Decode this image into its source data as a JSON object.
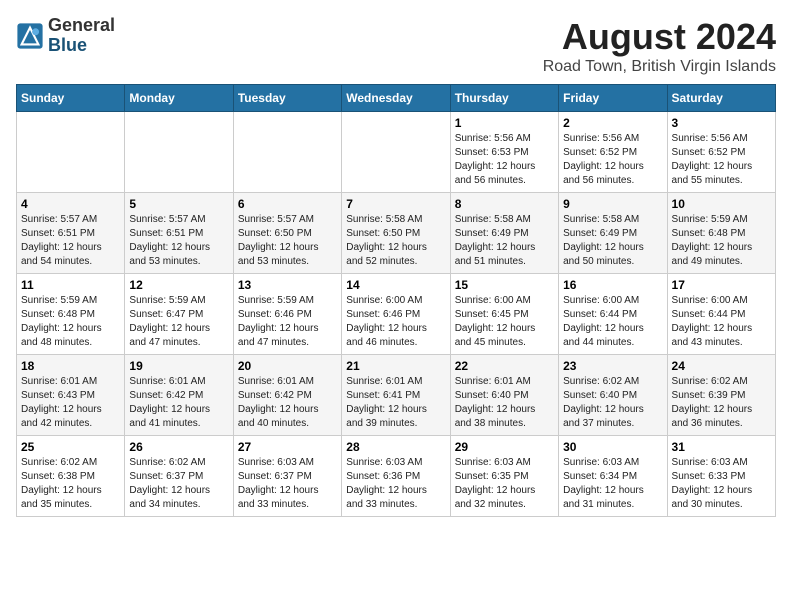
{
  "header": {
    "logo_general": "General",
    "logo_blue": "Blue",
    "month_year": "August 2024",
    "location": "Road Town, British Virgin Islands"
  },
  "calendar": {
    "weekdays": [
      "Sunday",
      "Monday",
      "Tuesday",
      "Wednesday",
      "Thursday",
      "Friday",
      "Saturday"
    ],
    "weeks": [
      [
        {
          "day": "",
          "info": ""
        },
        {
          "day": "",
          "info": ""
        },
        {
          "day": "",
          "info": ""
        },
        {
          "day": "",
          "info": ""
        },
        {
          "day": "1",
          "info": "Sunrise: 5:56 AM\nSunset: 6:53 PM\nDaylight: 12 hours\nand 56 minutes."
        },
        {
          "day": "2",
          "info": "Sunrise: 5:56 AM\nSunset: 6:52 PM\nDaylight: 12 hours\nand 56 minutes."
        },
        {
          "day": "3",
          "info": "Sunrise: 5:56 AM\nSunset: 6:52 PM\nDaylight: 12 hours\nand 55 minutes."
        }
      ],
      [
        {
          "day": "4",
          "info": "Sunrise: 5:57 AM\nSunset: 6:51 PM\nDaylight: 12 hours\nand 54 minutes."
        },
        {
          "day": "5",
          "info": "Sunrise: 5:57 AM\nSunset: 6:51 PM\nDaylight: 12 hours\nand 53 minutes."
        },
        {
          "day": "6",
          "info": "Sunrise: 5:57 AM\nSunset: 6:50 PM\nDaylight: 12 hours\nand 53 minutes."
        },
        {
          "day": "7",
          "info": "Sunrise: 5:58 AM\nSunset: 6:50 PM\nDaylight: 12 hours\nand 52 minutes."
        },
        {
          "day": "8",
          "info": "Sunrise: 5:58 AM\nSunset: 6:49 PM\nDaylight: 12 hours\nand 51 minutes."
        },
        {
          "day": "9",
          "info": "Sunrise: 5:58 AM\nSunset: 6:49 PM\nDaylight: 12 hours\nand 50 minutes."
        },
        {
          "day": "10",
          "info": "Sunrise: 5:59 AM\nSunset: 6:48 PM\nDaylight: 12 hours\nand 49 minutes."
        }
      ],
      [
        {
          "day": "11",
          "info": "Sunrise: 5:59 AM\nSunset: 6:48 PM\nDaylight: 12 hours\nand 48 minutes."
        },
        {
          "day": "12",
          "info": "Sunrise: 5:59 AM\nSunset: 6:47 PM\nDaylight: 12 hours\nand 47 minutes."
        },
        {
          "day": "13",
          "info": "Sunrise: 5:59 AM\nSunset: 6:46 PM\nDaylight: 12 hours\nand 47 minutes."
        },
        {
          "day": "14",
          "info": "Sunrise: 6:00 AM\nSunset: 6:46 PM\nDaylight: 12 hours\nand 46 minutes."
        },
        {
          "day": "15",
          "info": "Sunrise: 6:00 AM\nSunset: 6:45 PM\nDaylight: 12 hours\nand 45 minutes."
        },
        {
          "day": "16",
          "info": "Sunrise: 6:00 AM\nSunset: 6:44 PM\nDaylight: 12 hours\nand 44 minutes."
        },
        {
          "day": "17",
          "info": "Sunrise: 6:00 AM\nSunset: 6:44 PM\nDaylight: 12 hours\nand 43 minutes."
        }
      ],
      [
        {
          "day": "18",
          "info": "Sunrise: 6:01 AM\nSunset: 6:43 PM\nDaylight: 12 hours\nand 42 minutes."
        },
        {
          "day": "19",
          "info": "Sunrise: 6:01 AM\nSunset: 6:42 PM\nDaylight: 12 hours\nand 41 minutes."
        },
        {
          "day": "20",
          "info": "Sunrise: 6:01 AM\nSunset: 6:42 PM\nDaylight: 12 hours\nand 40 minutes."
        },
        {
          "day": "21",
          "info": "Sunrise: 6:01 AM\nSunset: 6:41 PM\nDaylight: 12 hours\nand 39 minutes."
        },
        {
          "day": "22",
          "info": "Sunrise: 6:01 AM\nSunset: 6:40 PM\nDaylight: 12 hours\nand 38 minutes."
        },
        {
          "day": "23",
          "info": "Sunrise: 6:02 AM\nSunset: 6:40 PM\nDaylight: 12 hours\nand 37 minutes."
        },
        {
          "day": "24",
          "info": "Sunrise: 6:02 AM\nSunset: 6:39 PM\nDaylight: 12 hours\nand 36 minutes."
        }
      ],
      [
        {
          "day": "25",
          "info": "Sunrise: 6:02 AM\nSunset: 6:38 PM\nDaylight: 12 hours\nand 35 minutes."
        },
        {
          "day": "26",
          "info": "Sunrise: 6:02 AM\nSunset: 6:37 PM\nDaylight: 12 hours\nand 34 minutes."
        },
        {
          "day": "27",
          "info": "Sunrise: 6:03 AM\nSunset: 6:37 PM\nDaylight: 12 hours\nand 33 minutes."
        },
        {
          "day": "28",
          "info": "Sunrise: 6:03 AM\nSunset: 6:36 PM\nDaylight: 12 hours\nand 33 minutes."
        },
        {
          "day": "29",
          "info": "Sunrise: 6:03 AM\nSunset: 6:35 PM\nDaylight: 12 hours\nand 32 minutes."
        },
        {
          "day": "30",
          "info": "Sunrise: 6:03 AM\nSunset: 6:34 PM\nDaylight: 12 hours\nand 31 minutes."
        },
        {
          "day": "31",
          "info": "Sunrise: 6:03 AM\nSunset: 6:33 PM\nDaylight: 12 hours\nand 30 minutes."
        }
      ]
    ]
  }
}
